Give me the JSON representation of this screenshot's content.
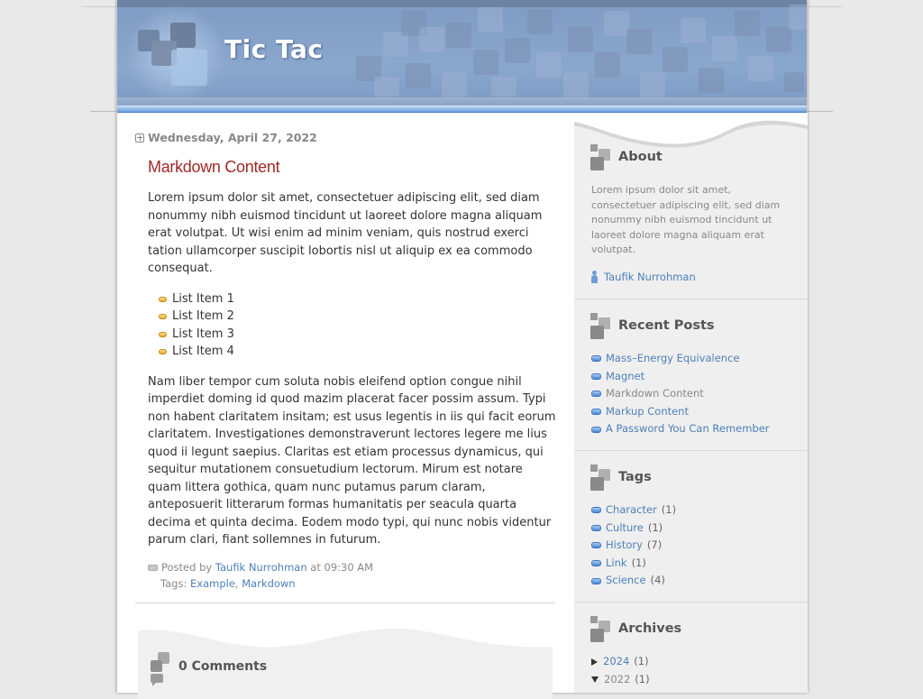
{
  "site": {
    "title": "Tic Tac"
  },
  "post": {
    "date": "Wednesday, April 27, 2022",
    "title": "Markdown Content",
    "paragraph1": "Lorem ipsum dolor sit amet, consectetuer adipiscing elit, sed diam nonummy nibh euismod tincidunt ut laoreet dolore magna aliquam erat volutpat. Ut wisi enim ad minim veniam, quis nostrud exerci tation ullamcorper suscipit lobortis nisl ut aliquip ex ea commodo consequat.",
    "list_items": [
      "List Item 1",
      "List Item 2",
      "List Item 3",
      "List Item 4"
    ],
    "paragraph2": "Nam liber tempor cum soluta nobis eleifend option congue nihil imperdiet doming id quod mazim placerat facer possim assum. Typi non habent claritatem insitam; est usus legentis in iis qui facit eorum claritatem. Investigationes demonstraverunt lectores legere me lius quod ii legunt saepius. Claritas est etiam processus dynamicus, qui sequitur mutationem consuetudium lectorum. Mirum est notare quam littera gothica, quam nunc putamus parum claram, anteposuerit litterarum formas humanitatis per seacula quarta decima et quinta decima. Eodem modo typi, qui nunc nobis videntur parum clari, fiant sollemnes in futurum.",
    "posted_by_prefix": "Posted by",
    "author": "Taufik Nurrohman",
    "time_prefix": "at",
    "time": "09:30 AM",
    "tags_prefix": "Tags:",
    "tags": [
      "Example",
      "Markdown"
    ],
    "tag_separator": ", ",
    "comments_title": "0 Comments"
  },
  "sidebar": {
    "about": {
      "title": "About",
      "text": "Lorem ipsum dolor sit amet, consectetuer adipiscing elit, sed diam nonummy nibh euismod tincidunt ut laoreet dolore magna aliquam erat volutpat.",
      "author": "Taufik Nurrohman"
    },
    "recent_posts": {
      "title": "Recent Posts",
      "items": [
        {
          "label": "Mass–Energy Equivalence",
          "current": false
        },
        {
          "label": "Magnet",
          "current": false
        },
        {
          "label": "Markdown Content",
          "current": true
        },
        {
          "label": "Markup Content",
          "current": false
        },
        {
          "label": "A Password You Can Remember",
          "current": false
        }
      ]
    },
    "tags": {
      "title": "Tags",
      "items": [
        {
          "label": "Character",
          "count": "(1)"
        },
        {
          "label": "Culture",
          "count": "(1)"
        },
        {
          "label": "History",
          "count": "(7)"
        },
        {
          "label": "Link",
          "count": "(1)"
        },
        {
          "label": "Science",
          "count": "(4)"
        }
      ]
    },
    "archives": {
      "title": "Archives",
      "items": [
        {
          "label": "2024",
          "count": "(1)",
          "expanded": false
        },
        {
          "label": "2022",
          "count": "(1)",
          "expanded": true
        }
      ]
    }
  },
  "colors": {
    "header_blue": "#8aa7cd",
    "title_red": "#a02a2a",
    "link_blue": "#4e7fb8",
    "sidebar_bg": "#efefef"
  }
}
